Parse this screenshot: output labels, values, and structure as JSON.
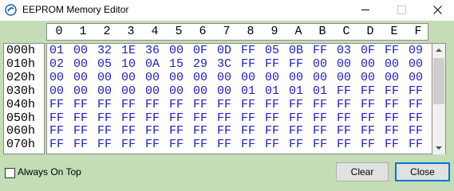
{
  "window": {
    "title": "EEPROM Memory Editor"
  },
  "title_controls": [
    "minimize-icon",
    "maximize-icon",
    "close-icon"
  ],
  "columns": [
    "0",
    "1",
    "2",
    "3",
    "4",
    "5",
    "6",
    "7",
    "8",
    "9",
    "A",
    "B",
    "C",
    "D",
    "E",
    "F"
  ],
  "rows": [
    "000h",
    "010h",
    "020h",
    "030h",
    "040h",
    "050h",
    "060h",
    "070h"
  ],
  "data": [
    [
      "01",
      "00",
      "32",
      "1E",
      "36",
      "00",
      "0F",
      "0D",
      "FF",
      "05",
      "0B",
      "FF",
      "03",
      "0F",
      "FF",
      "09"
    ],
    [
      "02",
      "00",
      "05",
      "10",
      "0A",
      "15",
      "29",
      "3C",
      "FF",
      "FF",
      "FF",
      "00",
      "00",
      "00",
      "00",
      "00"
    ],
    [
      "00",
      "00",
      "00",
      "00",
      "00",
      "00",
      "00",
      "00",
      "00",
      "00",
      "00",
      "00",
      "00",
      "00",
      "00",
      "00"
    ],
    [
      "00",
      "00",
      "00",
      "00",
      "00",
      "00",
      "00",
      "00",
      "01",
      "01",
      "01",
      "01",
      "FF",
      "FF",
      "FF",
      "FF"
    ],
    [
      "FF",
      "FF",
      "FF",
      "FF",
      "FF",
      "FF",
      "FF",
      "FF",
      "FF",
      "FF",
      "FF",
      "FF",
      "FF",
      "FF",
      "FF",
      "FF"
    ],
    [
      "FF",
      "FF",
      "FF",
      "FF",
      "FF",
      "FF",
      "FF",
      "FF",
      "FF",
      "FF",
      "FF",
      "FF",
      "FF",
      "FF",
      "FF",
      "FF"
    ],
    [
      "FF",
      "FF",
      "FF",
      "FF",
      "FF",
      "FF",
      "FF",
      "FF",
      "FF",
      "FF",
      "FF",
      "FF",
      "FF",
      "FF",
      "FF",
      "FF"
    ],
    [
      "FF",
      "FF",
      "FF",
      "FF",
      "FF",
      "FF",
      "FF",
      "FF",
      "FF",
      "FF",
      "FF",
      "FF",
      "FF",
      "FF",
      "FF",
      "FF"
    ]
  ],
  "always_on_top": {
    "label": "Always On Top",
    "checked": false
  },
  "buttons": {
    "clear": "Clear",
    "close": "Close"
  },
  "colors": {
    "background": "#c4ddb6",
    "data_text": "#2020c0",
    "focus_border": "#0078d7"
  }
}
